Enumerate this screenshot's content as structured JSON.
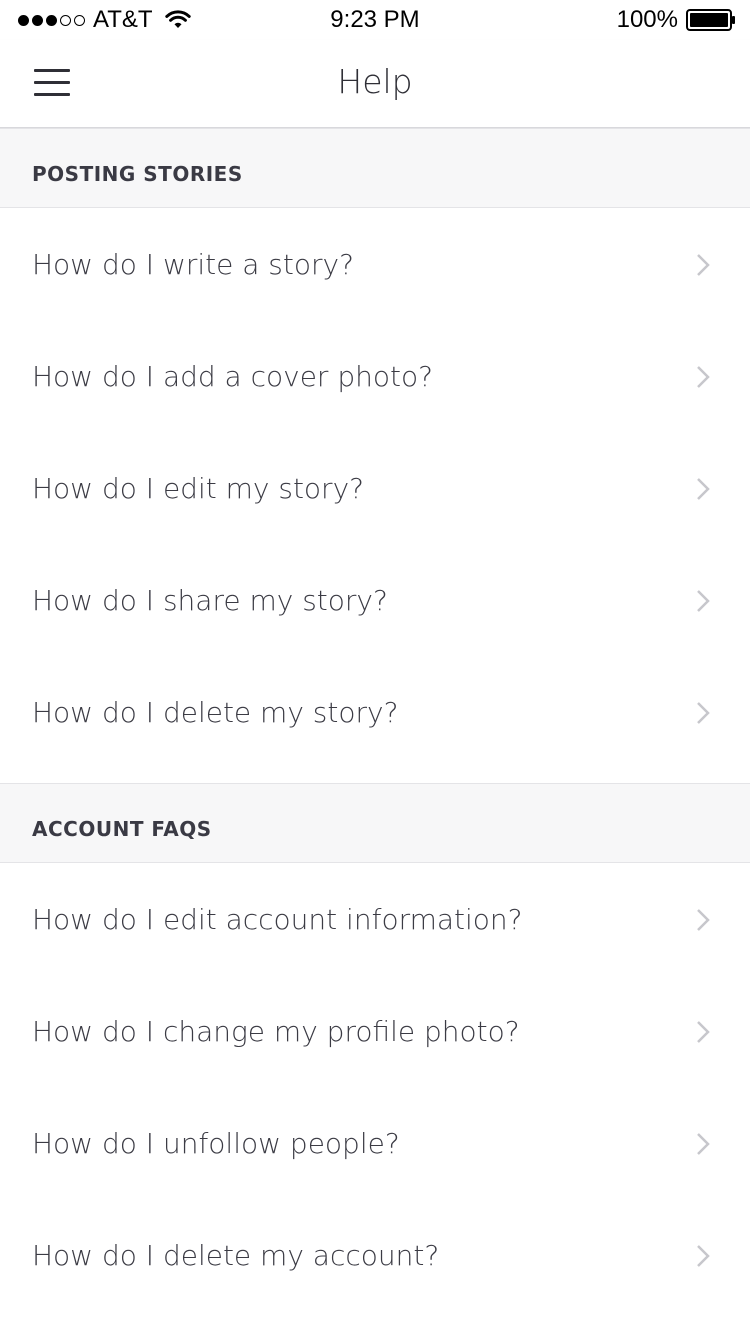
{
  "status_bar": {
    "carrier": "AT&T",
    "time": "9:23 PM",
    "battery": "100%",
    "signal_bars_filled": 3,
    "signal_bars_total": 5
  },
  "nav": {
    "title": "Help",
    "menu_icon": "hamburger-menu-icon"
  },
  "sections": [
    {
      "header": "POSTING STORIES",
      "items": [
        "How do I write a story?",
        "How do I add a cover photo?",
        "How do I edit my story?",
        "How do I share my story?",
        "How do I delete my story?"
      ]
    },
    {
      "header": "ACCOUNT FAQS",
      "items": [
        "How do I edit account information?",
        "How do I change my profile photo?",
        "How do I unfollow people?",
        "How do I delete my account?"
      ]
    }
  ],
  "colors": {
    "text": "#2f2f36",
    "section_bg": "#f7f7f8",
    "chevron": "#c7c7cc"
  }
}
